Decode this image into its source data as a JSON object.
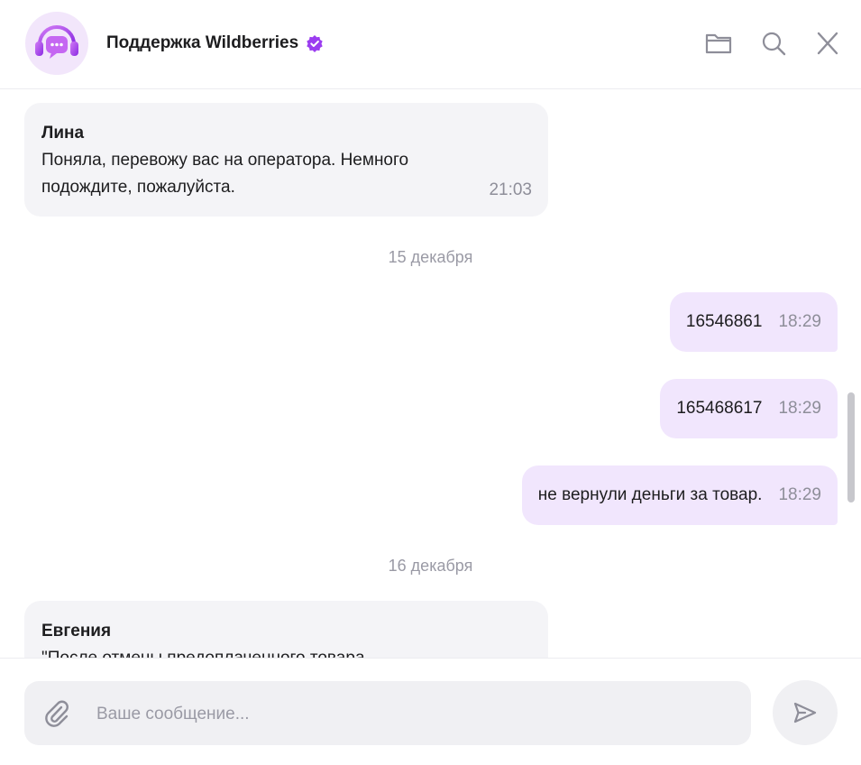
{
  "header": {
    "title": "Поддержка Wildberries",
    "avatar_icon": "headset-chat-icon",
    "verified_icon": "verified-check-icon",
    "accent_color": "#9b3df0",
    "actions": [
      {
        "icon": "folder-icon"
      },
      {
        "icon": "search-icon"
      },
      {
        "icon": "close-icon"
      }
    ]
  },
  "messages": [
    {
      "type": "incoming",
      "sender": "Лина",
      "lines": [
        "Поняла, перевожу вас на оператора. Немного",
        "подождите, пожалуйста."
      ],
      "time": "21:03"
    },
    {
      "type": "date",
      "text": "15 декабря"
    },
    {
      "type": "outgoing",
      "text": "16546861",
      "time": "18:29"
    },
    {
      "type": "outgoing",
      "text": "165468617",
      "time": "18:29"
    },
    {
      "type": "outgoing",
      "text": "не вернули деньги за товар.",
      "time": "18:29"
    },
    {
      "type": "date",
      "text": "16 декабря"
    },
    {
      "type": "incoming",
      "sender": "Евгения",
      "lines": [
        "\"После отмены предоплаченного товара"
      ]
    }
  ],
  "composer": {
    "placeholder": "Ваше сообщение...",
    "value": "",
    "attach_icon": "paperclip-icon",
    "send_icon": "send-icon"
  }
}
